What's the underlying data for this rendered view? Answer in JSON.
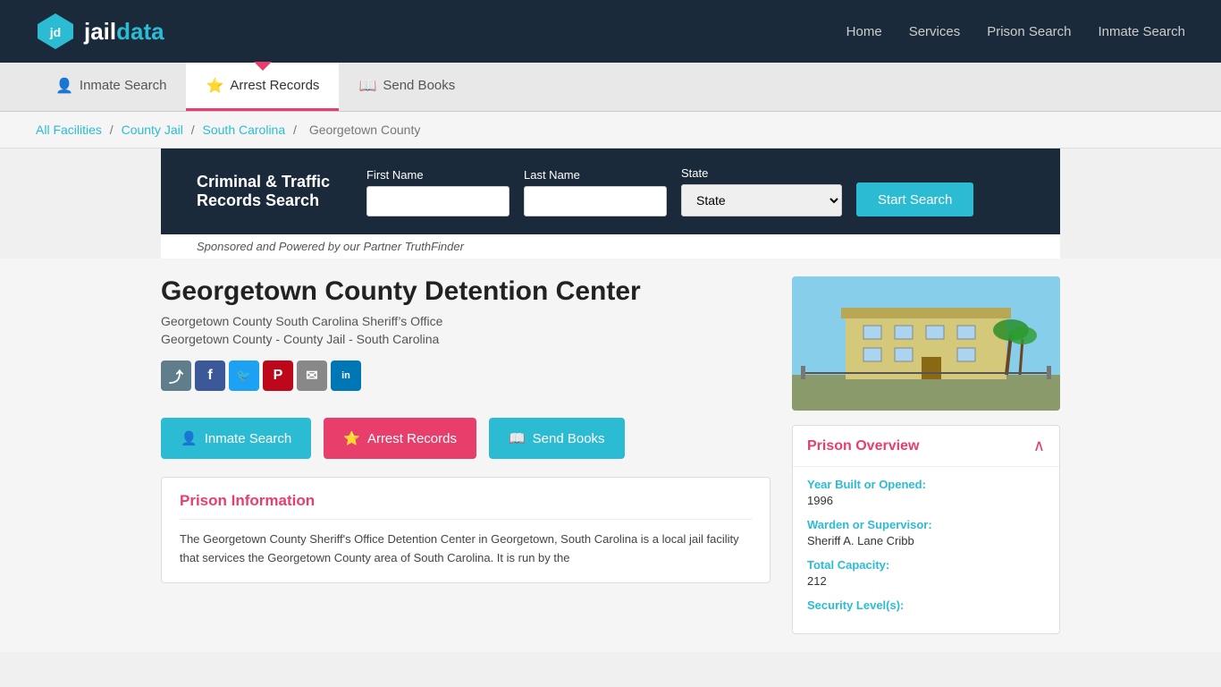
{
  "header": {
    "logo_jail": "jd",
    "logo_text_jail": "jail",
    "logo_text_data": "data",
    "nav": [
      {
        "label": "Home",
        "id": "home"
      },
      {
        "label": "Services",
        "id": "services"
      },
      {
        "label": "Prison Search",
        "id": "prison-search"
      },
      {
        "label": "Inmate Search",
        "id": "inmate-search"
      }
    ]
  },
  "tabs": [
    {
      "label": "Inmate Search",
      "icon": "👤",
      "active": false,
      "id": "tab-inmate"
    },
    {
      "label": "Arrest Records",
      "icon": "⭐",
      "active": true,
      "id": "tab-arrest"
    },
    {
      "label": "Send Books",
      "icon": "📖",
      "active": false,
      "id": "tab-books"
    }
  ],
  "breadcrumb": {
    "items": [
      {
        "label": "All Facilities",
        "link": true
      },
      {
        "label": "County Jail",
        "link": true
      },
      {
        "label": "South Carolina",
        "link": true
      },
      {
        "label": "Georgetown County",
        "link": false
      }
    ]
  },
  "search": {
    "title_line1": "Criminal & Traffic",
    "title_line2": "Records Search",
    "first_name_label": "First Name",
    "first_name_placeholder": "",
    "last_name_label": "Last Name",
    "last_name_placeholder": "",
    "state_label": "State",
    "state_default": "State",
    "start_search_label": "Start Search",
    "sponsored_text": "Sponsored and Powered by our Partner TruthFinder"
  },
  "facility": {
    "title": "Georgetown County Detention Center",
    "subtitle1": "Georgetown County South Carolina Sheriff’s Office",
    "subtitle2": "Georgetown County - County Jail - South Carolina"
  },
  "action_buttons": [
    {
      "label": "Inmate Search",
      "icon": "👤",
      "class": "btn-inmate",
      "id": "inmate-btn"
    },
    {
      "label": "Arrest Records",
      "icon": "⭐",
      "class": "btn-arrest",
      "id": "arrest-btn"
    },
    {
      "label": "Send Books",
      "icon": "📖",
      "class": "btn-books",
      "id": "books-btn"
    }
  ],
  "prison_info": {
    "section_title": "Prison Information",
    "description": "The Georgetown County Sheriff's Office Detention Center in Georgetown, South Carolina is a local jail facility that services the Georgetown County area of South Carolina.  It is run by the"
  },
  "prison_overview": {
    "title": "Prison Overview",
    "fields": [
      {
        "label": "Year Built or Opened:",
        "value": "1996"
      },
      {
        "label": "Warden or Supervisor:",
        "value": "Sheriff A. Lane Cribb"
      },
      {
        "label": "Total Capacity:",
        "value": "212"
      },
      {
        "label": "Security Level(s):",
        "value": ""
      }
    ]
  },
  "social": [
    {
      "icon": "⤴",
      "label": "Share",
      "class": "soc-share"
    },
    {
      "icon": "f",
      "label": "Facebook",
      "class": "soc-fb"
    },
    {
      "icon": "🐦",
      "label": "Twitter",
      "class": "soc-tw"
    },
    {
      "icon": "P",
      "label": "Pinterest",
      "class": "soc-pin"
    },
    {
      "icon": "✉",
      "label": "Email",
      "class": "soc-email"
    },
    {
      "icon": "in",
      "label": "LinkedIn",
      "class": "soc-li"
    }
  ]
}
